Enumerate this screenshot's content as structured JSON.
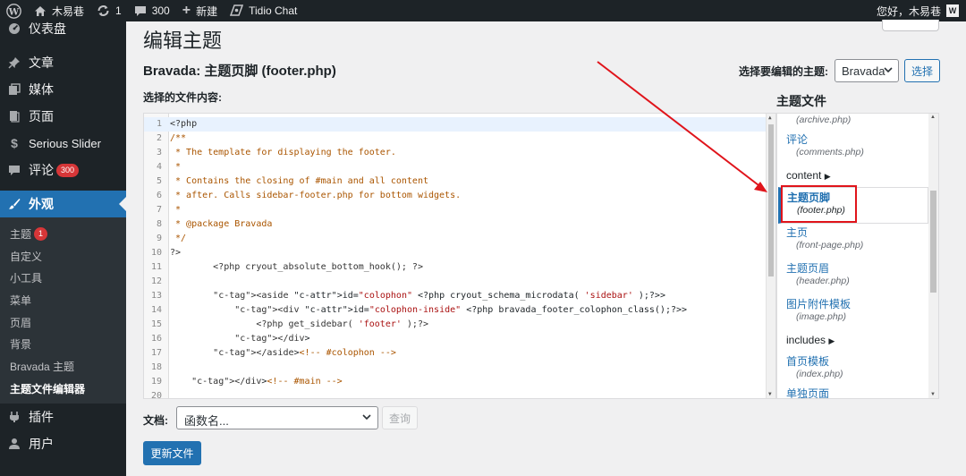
{
  "admin_bar": {
    "site_name": "木易巷",
    "updates_count": "1",
    "comments_count": "300",
    "new_label": "新建",
    "plugin_label": "Tidio Chat",
    "greeting": "您好，木易巷",
    "avatar_letter": "W"
  },
  "sidebar": {
    "items": [
      {
        "label": "仪表盘",
        "icon": "dashboard-icon"
      },
      {
        "label": "文章",
        "icon": "pin-icon"
      },
      {
        "label": "媒体",
        "icon": "media-icon"
      },
      {
        "label": "页面",
        "icon": "page-icon"
      },
      {
        "label": "Serious Slider",
        "icon": "slider-icon"
      },
      {
        "label": "评论",
        "icon": "comment-icon",
        "badge": "300"
      },
      {
        "label": "外观",
        "icon": "brush-icon"
      },
      {
        "label": "插件",
        "icon": "plugin-icon"
      },
      {
        "label": "用户",
        "icon": "user-icon"
      }
    ],
    "submenu": [
      {
        "label": "主题",
        "badge": "1"
      },
      {
        "label": "自定义"
      },
      {
        "label": "小工具"
      },
      {
        "label": "菜单"
      },
      {
        "label": "页眉"
      },
      {
        "label": "背景"
      },
      {
        "label": "Bravada 主题"
      },
      {
        "label": "主题文件编辑器"
      }
    ]
  },
  "page": {
    "title": "编辑主题",
    "file_title": "Bravada: 主题页脚 (footer.php)",
    "theme_select_label": "选择要编辑的主题:",
    "theme_selected": "Bravada",
    "select_button": "选择",
    "content_label": "选择的文件内容:",
    "theme_files_title": "主题文件"
  },
  "editor": {
    "lines": [
      "<?php",
      "/**",
      " * The template for displaying the footer.",
      " *",
      " * Contains the closing of #main and all content",
      " * after. Calls sidebar-footer.php for bottom widgets.",
      " *",
      " * @package Bravada",
      " */",
      "?>",
      "        <?php cryout_absolute_bottom_hook(); ?>",
      "",
      "        <aside id=\"colophon\" <?php cryout_schema_microdata( 'sidebar' );?>>",
      "            <div id=\"colophon-inside\" <?php bravada_footer_colophon_class();?>>",
      "                <?php get_sidebar( 'footer' );?>",
      "            </div>",
      "        </aside><!-- #colophon -->",
      "",
      "    </div><!-- #main -->",
      ""
    ]
  },
  "files": [
    {
      "name": "",
      "file": "(archive.php)"
    },
    {
      "name": "评论",
      "file": "(comments.php)"
    },
    {
      "folder": "content"
    },
    {
      "name": "主题页脚",
      "file": "(footer.php)",
      "current": true
    },
    {
      "name": "主页",
      "file": "(front-page.php)"
    },
    {
      "name": "主题页眉",
      "file": "(header.php)"
    },
    {
      "name": "图片附件模板",
      "file": "(image.php)"
    },
    {
      "folder": "includes"
    },
    {
      "name": "首页模板",
      "file": "(index.php)"
    },
    {
      "name": "单独页面",
      "file": ""
    }
  ],
  "footer": {
    "doc_label": "文档:",
    "doc_placeholder": "函数名...",
    "lookup_button": "查询",
    "update_button": "更新文件"
  },
  "colors": {
    "accent": "#2271b1",
    "admin_dark": "#1d2327",
    "highlight": "#e0141b"
  }
}
